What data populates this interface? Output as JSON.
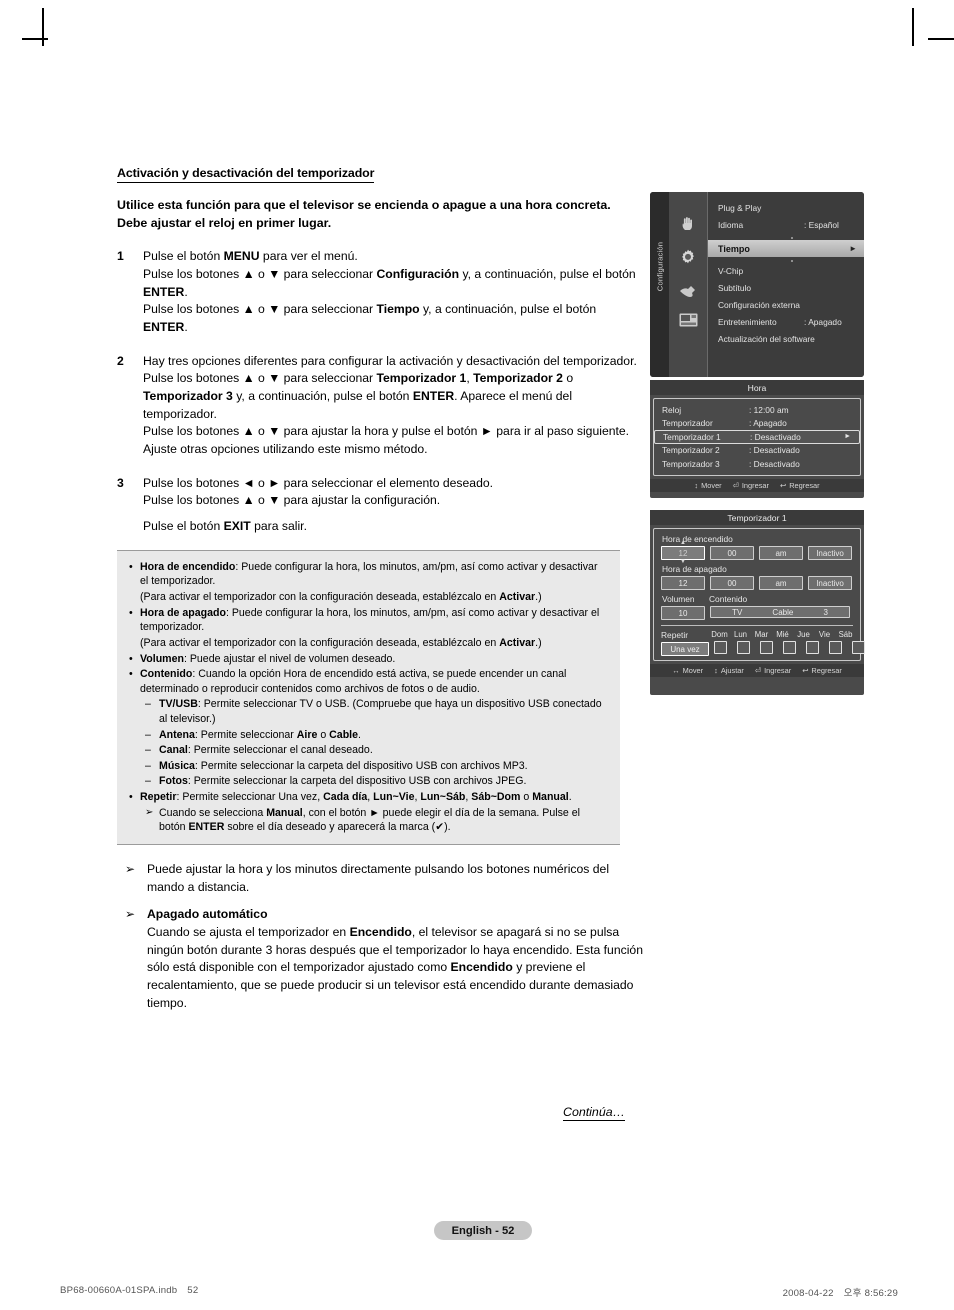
{
  "document": {
    "section_title": "Activación y desactivación del temporizador",
    "intro": "Utilice esta función para que el televisor se encienda o apague a una hora concreta. Debe ajustar el reloj en primer lugar.",
    "continued_label": "Continúa…",
    "page_label": "English - 52",
    "print_file": "BP68-00660A-01SPA.indb",
    "print_page": "52",
    "print_date": "2008-04-22",
    "print_time_prefix": "오후",
    "print_time": "8:56:29"
  },
  "steps": [
    {
      "num": "1",
      "lines": [
        [
          {
            "t": "Pulse el botón "
          },
          {
            "t": "MENU",
            "b": true
          },
          {
            "t": " para ver el menú."
          }
        ],
        [
          {
            "t": "Pulse los botones ▲ o ▼ para seleccionar "
          },
          {
            "t": "Configuración",
            "b": true
          },
          {
            "t": " y, a continuación, pulse el botón "
          },
          {
            "t": "ENTER",
            "b": true
          },
          {
            "t": "."
          }
        ],
        [
          {
            "t": "Pulse los botones ▲ o ▼ para seleccionar "
          },
          {
            "t": "Tiempo",
            "b": true
          },
          {
            "t": " y, a continuación, pulse el botón "
          },
          {
            "t": "ENTER",
            "b": true
          },
          {
            "t": "."
          }
        ]
      ]
    },
    {
      "num": "2",
      "lines": [
        [
          {
            "t": "Hay tres opciones diferentes para configurar la activación y desactivación del temporizador."
          }
        ],
        [
          {
            "t": "Pulse los botones ▲ o ▼ para seleccionar "
          },
          {
            "t": "Temporizador 1",
            "b": true
          },
          {
            "t": ", "
          },
          {
            "t": "Temporizador 2",
            "b": true
          },
          {
            "t": " o "
          },
          {
            "t": "Temporizador 3",
            "b": true
          },
          {
            "t": " y, a continuación, pulse el botón "
          },
          {
            "t": "ENTER",
            "b": true
          },
          {
            "t": ". Aparece el menú del temporizador."
          }
        ],
        [
          {
            "t": "Pulse los botones ▲ o ▼ para ajustar la hora y pulse el botón ► para ir al paso siguiente. Ajuste otras opciones utilizando este mismo método."
          }
        ]
      ]
    },
    {
      "num": "3",
      "lines": [
        [
          {
            "t": "Pulse los botones ◄ o ► para seleccionar el elemento deseado."
          }
        ],
        [
          {
            "t": "Pulse los botones ▲ o ▼ para ajustar la configuración."
          }
        ],
        [
          {
            "t": ""
          }
        ],
        [
          {
            "t": "Pulse el botón "
          },
          {
            "t": "EXIT",
            "b": true
          },
          {
            "t": " para salir."
          }
        ]
      ]
    }
  ],
  "infobox": {
    "items": [
      {
        "type": "bullet",
        "parts": [
          {
            "t": "Hora de encendido",
            "b": true
          },
          {
            "t": ": Puede configurar la hora, los minutos, am/pm, así como activar y desactivar el temporizador."
          }
        ]
      },
      {
        "type": "plain",
        "parts": [
          {
            "t": "(Para activar el temporizador con la configuración deseada, establézcalo en "
          },
          {
            "t": "Activar",
            "b": true
          },
          {
            "t": ".)"
          }
        ]
      },
      {
        "type": "bullet",
        "parts": [
          {
            "t": "Hora de apagado",
            "b": true
          },
          {
            "t": ": Puede configurar la hora, los minutos, am/pm, así como activar y desactivar el temporizador."
          }
        ]
      },
      {
        "type": "plain",
        "parts": [
          {
            "t": "(Para activar el temporizador con la configuración deseada, establézcalo en "
          },
          {
            "t": "Activar",
            "b": true
          },
          {
            "t": ".)"
          }
        ]
      },
      {
        "type": "bullet",
        "parts": [
          {
            "t": "Volumen",
            "b": true
          },
          {
            "t": ": Puede ajustar el nivel de volumen deseado."
          }
        ]
      },
      {
        "type": "bullet",
        "parts": [
          {
            "t": "Contenido",
            "b": true
          },
          {
            "t": ": Cuando la opción Hora de encendido está activa, se puede encender un canal determinado o reproducir contenidos como archivos de fotos o de audio."
          }
        ]
      },
      {
        "type": "sub",
        "parts": [
          {
            "t": "TV/USB",
            "b": true
          },
          {
            "t": ": Permite seleccionar TV o USB. (Compruebe que haya un dispositivo USB conectado al televisor.)"
          }
        ]
      },
      {
        "type": "sub",
        "parts": [
          {
            "t": "Antena",
            "b": true
          },
          {
            "t": ": Permite seleccionar "
          },
          {
            "t": "Aire",
            "b": true
          },
          {
            "t": " o "
          },
          {
            "t": "Cable",
            "b": true
          },
          {
            "t": "."
          }
        ]
      },
      {
        "type": "sub",
        "parts": [
          {
            "t": "Canal",
            "b": true
          },
          {
            "t": ": Permite seleccionar el canal deseado."
          }
        ]
      },
      {
        "type": "sub",
        "parts": [
          {
            "t": "Música",
            "b": true
          },
          {
            "t": ": Permite seleccionar la carpeta del dispositivo USB con archivos MP3."
          }
        ]
      },
      {
        "type": "sub",
        "parts": [
          {
            "t": "Fotos",
            "b": true
          },
          {
            "t": ": Permite seleccionar la carpeta del dispositivo USB con archivos JPEG."
          }
        ]
      },
      {
        "type": "bullet",
        "parts": [
          {
            "t": "Repetir",
            "b": true
          },
          {
            "t": ": Permite seleccionar Una vez, "
          },
          {
            "t": "Cada día",
            "b": true
          },
          {
            "t": ", "
          },
          {
            "t": "Lun~Vie",
            "b": true
          },
          {
            "t": ", "
          },
          {
            "t": "Lun~Sáb",
            "b": true
          },
          {
            "t": ", "
          },
          {
            "t": "Sáb~Dom",
            "b": true
          },
          {
            "t": " o "
          },
          {
            "t": "Manual",
            "b": true
          },
          {
            "t": "."
          }
        ]
      },
      {
        "type": "arrow",
        "parts": [
          {
            "t": "Cuando se selecciona "
          },
          {
            "t": "Manual",
            "b": true
          },
          {
            "t": ", con el botón ► puede elegir el día de la semana. Pulse el botón "
          },
          {
            "t": "ENTER",
            "b": true
          },
          {
            "t": " sobre el día deseado y aparecerá la marca (✔)."
          }
        ]
      }
    ]
  },
  "notes": [
    {
      "header": "",
      "parts": [
        {
          "t": "Puede ajustar la hora y los minutos directamente pulsando los botones numéricos del mando a distancia."
        }
      ]
    },
    {
      "header": "Apagado automático",
      "parts": [
        {
          "t": "Cuando se ajusta el temporizador en "
        },
        {
          "t": "Encendido",
          "b": true
        },
        {
          "t": ", el televisor se apagará si no se pulsa ningún botón durante 3 horas después que el temporizador lo haya encendido."
        },
        {
          "t": " Esta función sólo está disponible con el temporizador ajustado como "
        },
        {
          "t": "Encendido",
          "b": true
        },
        {
          "t": " y previene el recalentamiento, que se puede producir si un televisor está encendido durante demasiado tiempo."
        }
      ]
    }
  ],
  "osd1": {
    "tab_label": "Configuración",
    "icons": [
      "hand-icon",
      "gear-icon",
      "plug-icon",
      "card-icon"
    ],
    "rows": [
      {
        "label": "Plug & Play",
        "value": ""
      },
      {
        "label": "Idioma",
        "value": ": Español"
      },
      {
        "label": "V-Chip",
        "value": ""
      },
      {
        "label": "Subtítulo",
        "value": ""
      },
      {
        "label": "Configuración externa",
        "value": ""
      },
      {
        "label": "Entretenimiento",
        "value": ": Apagado"
      },
      {
        "label": "Actualización del software",
        "value": ""
      }
    ],
    "highlight": {
      "label": "Tiempo",
      "arrow": "►"
    }
  },
  "osd2": {
    "title": "Hora",
    "rows": [
      {
        "label": "Reloj",
        "value": ": 12:00 am",
        "selected": false
      },
      {
        "label": "Temporizador",
        "value": ": Apagado",
        "selected": false
      },
      {
        "label": "Temporizador 1",
        "value": ": Desactivado",
        "selected": true,
        "arrow": "►"
      },
      {
        "label": "Temporizador 2",
        "value": ": Desactivado",
        "selected": false
      },
      {
        "label": "Temporizador 3",
        "value": ": Desactivado",
        "selected": false
      }
    ],
    "hints": [
      {
        "glyph": "↕",
        "text": "Mover"
      },
      {
        "glyph": "⏎",
        "text": "Ingresar"
      },
      {
        "glyph": "↩",
        "text": "Regresar"
      }
    ]
  },
  "osd3": {
    "title": "Temporizador 1",
    "on_label": "Hora de encendido",
    "on_fields": [
      "12",
      "00",
      "am",
      "Inactivo"
    ],
    "off_label": "Hora de apagado",
    "off_fields": [
      "12",
      "00",
      "am",
      "Inactivo"
    ],
    "volume_label": "Volumen",
    "content_label": "Contenido",
    "volume_value": "10",
    "content_values": [
      "TV",
      "Cable",
      "3"
    ],
    "repeat_label": "Repetir",
    "repeat_value": "Una vez",
    "days": [
      "Dom",
      "Lun",
      "Mar",
      "Mié",
      "Jue",
      "Vie",
      "Sáb"
    ],
    "day_checked": [
      false,
      false,
      false,
      false,
      false,
      false,
      false
    ],
    "hints": [
      {
        "glyph": "↔",
        "text": "Mover"
      },
      {
        "glyph": "↕",
        "text": "Ajustar"
      },
      {
        "glyph": "⏎",
        "text": "Ingresar"
      },
      {
        "glyph": "↩",
        "text": "Regresar"
      }
    ]
  }
}
